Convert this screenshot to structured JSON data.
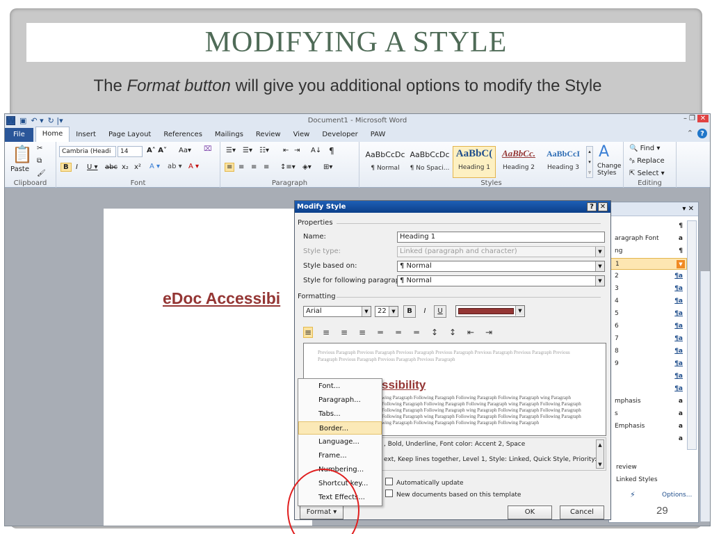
{
  "slide": {
    "title": "MODIFYING A STYLE",
    "subtitle_pre": "The ",
    "subtitle_em": "Format button",
    "subtitle_post": " will give you additional options to modify the Style",
    "number": "29"
  },
  "window": {
    "title": "Document1 - Microsoft Word"
  },
  "tabs": [
    "File",
    "Home",
    "Insert",
    "Page Layout",
    "References",
    "Mailings",
    "Review",
    "View",
    "Developer",
    "PAW"
  ],
  "ribbon": {
    "clipboard": {
      "label": "Clipboard",
      "paste": "Paste"
    },
    "font": {
      "label": "Font",
      "name": "Cambria (Headi",
      "size": "14"
    },
    "paragraph": {
      "label": "Paragraph"
    },
    "styles": {
      "label": "Styles",
      "tiles": [
        {
          "sample": "AaBbCcDc",
          "name": "¶ Normal"
        },
        {
          "sample": "AaBbCcDc",
          "name": "¶ No Spaci..."
        },
        {
          "sample": "AaBbC(",
          "name": "Heading 1"
        },
        {
          "sample": "AaBbCc.",
          "name": "Heading 2"
        },
        {
          "sample": "AaBbCcI",
          "name": "Heading 3"
        }
      ],
      "change_styles": "Change Styles"
    },
    "editing": {
      "label": "Editing",
      "find": "Find",
      "replace": "Replace",
      "select": "Select"
    }
  },
  "document": {
    "heading": "eDoc Accessibi"
  },
  "styles_pane": {
    "rows": [
      {
        "text": "",
        "mark": "¶"
      },
      {
        "text": "aragraph Font",
        "mark": "a"
      },
      {
        "text": "ng",
        "mark": "¶"
      },
      {
        "text": "1",
        "mark": ""
      },
      {
        "text": "2",
        "mark": "¶a"
      },
      {
        "text": "3",
        "mark": "¶a"
      },
      {
        "text": "4",
        "mark": "¶a"
      },
      {
        "text": "5",
        "mark": "¶a"
      },
      {
        "text": "6",
        "mark": "¶a"
      },
      {
        "text": "7",
        "mark": "¶a"
      },
      {
        "text": "8",
        "mark": "¶a"
      },
      {
        "text": "9",
        "mark": "¶a"
      },
      {
        "text": "",
        "mark": "¶a"
      },
      {
        "text": "",
        "mark": "¶a"
      },
      {
        "text": "mphasis",
        "mark": "a"
      },
      {
        "text": "s",
        "mark": "a"
      },
      {
        "text": "Emphasis",
        "mark": "a"
      },
      {
        "text": "",
        "mark": "a"
      }
    ],
    "preview": "review",
    "linked": "Linked Styles",
    "options": "Options..."
  },
  "dialog": {
    "title": "Modify Style",
    "properties": "Properties",
    "name_label": "Name:",
    "name_value": "Heading 1",
    "style_type_label": "Style type:",
    "style_type_value": "Linked (paragraph and character)",
    "based_on_label": "Style based on:",
    "based_on_value": "¶  Normal",
    "following_label": "Style for following paragraph:",
    "following_value": "¶  Normal",
    "formatting": "Formatting",
    "font_name": "Arial",
    "font_size": "22",
    "preview_prev": "Previous Paragraph Previous Paragraph Previous Paragraph Previous Paragraph Previous Paragraph Previous Paragraph Previous Paragraph Previous Paragraph Previous Paragraph Previous Paragraph",
    "preview_heading": "ssibility",
    "preview_follow": "wing Paragraph Following Paragraph Following Paragraph Following Paragraph wing Paragraph Following Paragraph Following Paragraph Following Paragraph wing Paragraph Following Paragraph Following Paragraph Following Paragraph wing Paragraph Following Paragraph Following Paragraph Following Paragraph wing Paragraph Following Paragraph Following Paragraph Following Paragraph wing Paragraph Following Paragraph Following Paragraph Following Paragraph",
    "desc_line1": ", Bold, Underline, Font color: Accent 2, Space",
    "desc_line2": "ext, Keep lines together, Level 1, Style: Linked, Quick Style, Priority:",
    "auto_update": "Automatically update",
    "new_docs": "New documents based on this template",
    "format_btn": "Format ▾",
    "ok": "OK",
    "cancel": "Cancel"
  },
  "format_menu": {
    "items": [
      "Font...",
      "Paragraph...",
      "Tabs...",
      "Border...",
      "Language...",
      "Frame...",
      "Numbering...",
      "Shortcut key...",
      "Text Effects..."
    ],
    "highlighted_index": 3
  },
  "colors": {
    "heading": "#943634",
    "title": "#4f6b57",
    "accent": "#2a5699"
  }
}
